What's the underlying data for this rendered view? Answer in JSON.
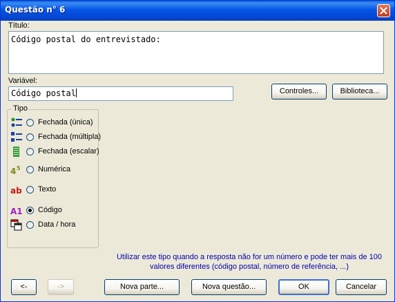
{
  "window": {
    "title": "Questão n° 6"
  },
  "fields": {
    "titulo_label": "Título:",
    "titulo_value": "Código postal do entrevistado:",
    "variavel_label": "Variável:",
    "variavel_value": "Código postal"
  },
  "side_buttons": {
    "controles": "Controles...",
    "biblioteca": "Biblioteca..."
  },
  "tipo": {
    "legend": "Tipo",
    "options": [
      {
        "label": "Fechada (única)",
        "icon": "single-choice-icon",
        "selected": false
      },
      {
        "label": "Fechada (múltipla)",
        "icon": "multiple-choice-icon",
        "selected": false
      },
      {
        "label": "Fechada (escalar)",
        "icon": "scale-icon",
        "selected": false
      },
      {
        "label": "Numérica",
        "icon": "numeric-icon",
        "selected": false
      },
      {
        "label": "Texto",
        "icon": "text-icon",
        "selected": false
      },
      {
        "label": "Código",
        "icon": "code-icon",
        "selected": true
      },
      {
        "label": "Data / hora",
        "icon": "date-time-icon",
        "selected": false
      }
    ]
  },
  "hint": {
    "line1": "Utilizar este tipo quando a resposta não for um número e pode ter mais de 100",
    "line2": "valores diferentes (código postal, número de referência, ...)"
  },
  "footer": {
    "prev": "<-",
    "next": "->",
    "nova_parte": "Nova parte...",
    "nova_questao": "Nova questão...",
    "ok": "OK",
    "cancelar": "Cancelar"
  },
  "colors": {
    "titlebar": "#0555e6",
    "dialog_bg": "#ece9d8",
    "hint_text": "#0000b0",
    "radio_selected": "#21a121"
  }
}
